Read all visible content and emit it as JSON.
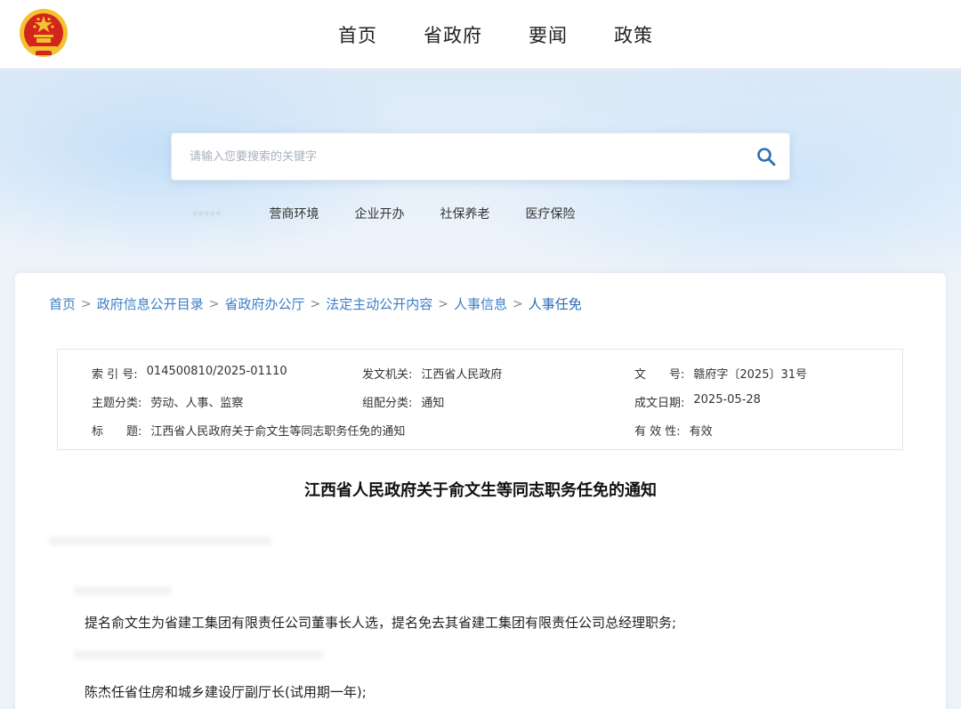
{
  "nav": {
    "items": [
      "首页",
      "省政府",
      "要闻",
      "政策"
    ]
  },
  "search": {
    "placeholder": "请输入您要搜索的关键字"
  },
  "hotwords": [
    "营商环境",
    "企业开办",
    "社保养老",
    "医疗保险"
  ],
  "breadcrumb": [
    "首页",
    "政府信息公开目录",
    "省政府办公厅",
    "法定主动公开内容",
    "人事信息",
    "人事任免"
  ],
  "meta": {
    "index_label": "索 引 号:",
    "index_value": "014500810/2025-01110",
    "issuer_label": "发文机关:",
    "issuer_value": "江西省人民政府",
    "docno_label": "文　　号:",
    "docno_value": "赣府字〔2025〕31号",
    "topic_label": "主题分类:",
    "topic_value": "劳动、人事、监察",
    "category_label": "组配分类:",
    "category_value": "通知",
    "date_label": "成文日期:",
    "date_value": "2025-05-28",
    "title_label": "标　　题:",
    "title_value": "江西省人民政府关于俞文生等同志职务任免的通知",
    "validity_label": "有 效 性:",
    "validity_value": "有效"
  },
  "document": {
    "title": "江西省人民政府关于俞文生等同志职务任免的通知",
    "paragraphs": [
      "提名俞文生为省建工集团有限责任公司董事长人选，提名免去其省建工集团有限责任公司总经理职务;",
      "陈杰任省住房和城乡建设厅副厅长(试用期一年);"
    ]
  },
  "colors": {
    "link": "#3d7fc6",
    "search_icon": "#2f6db5",
    "emblem_red": "#d4241c",
    "emblem_gold": "#f2c230"
  }
}
